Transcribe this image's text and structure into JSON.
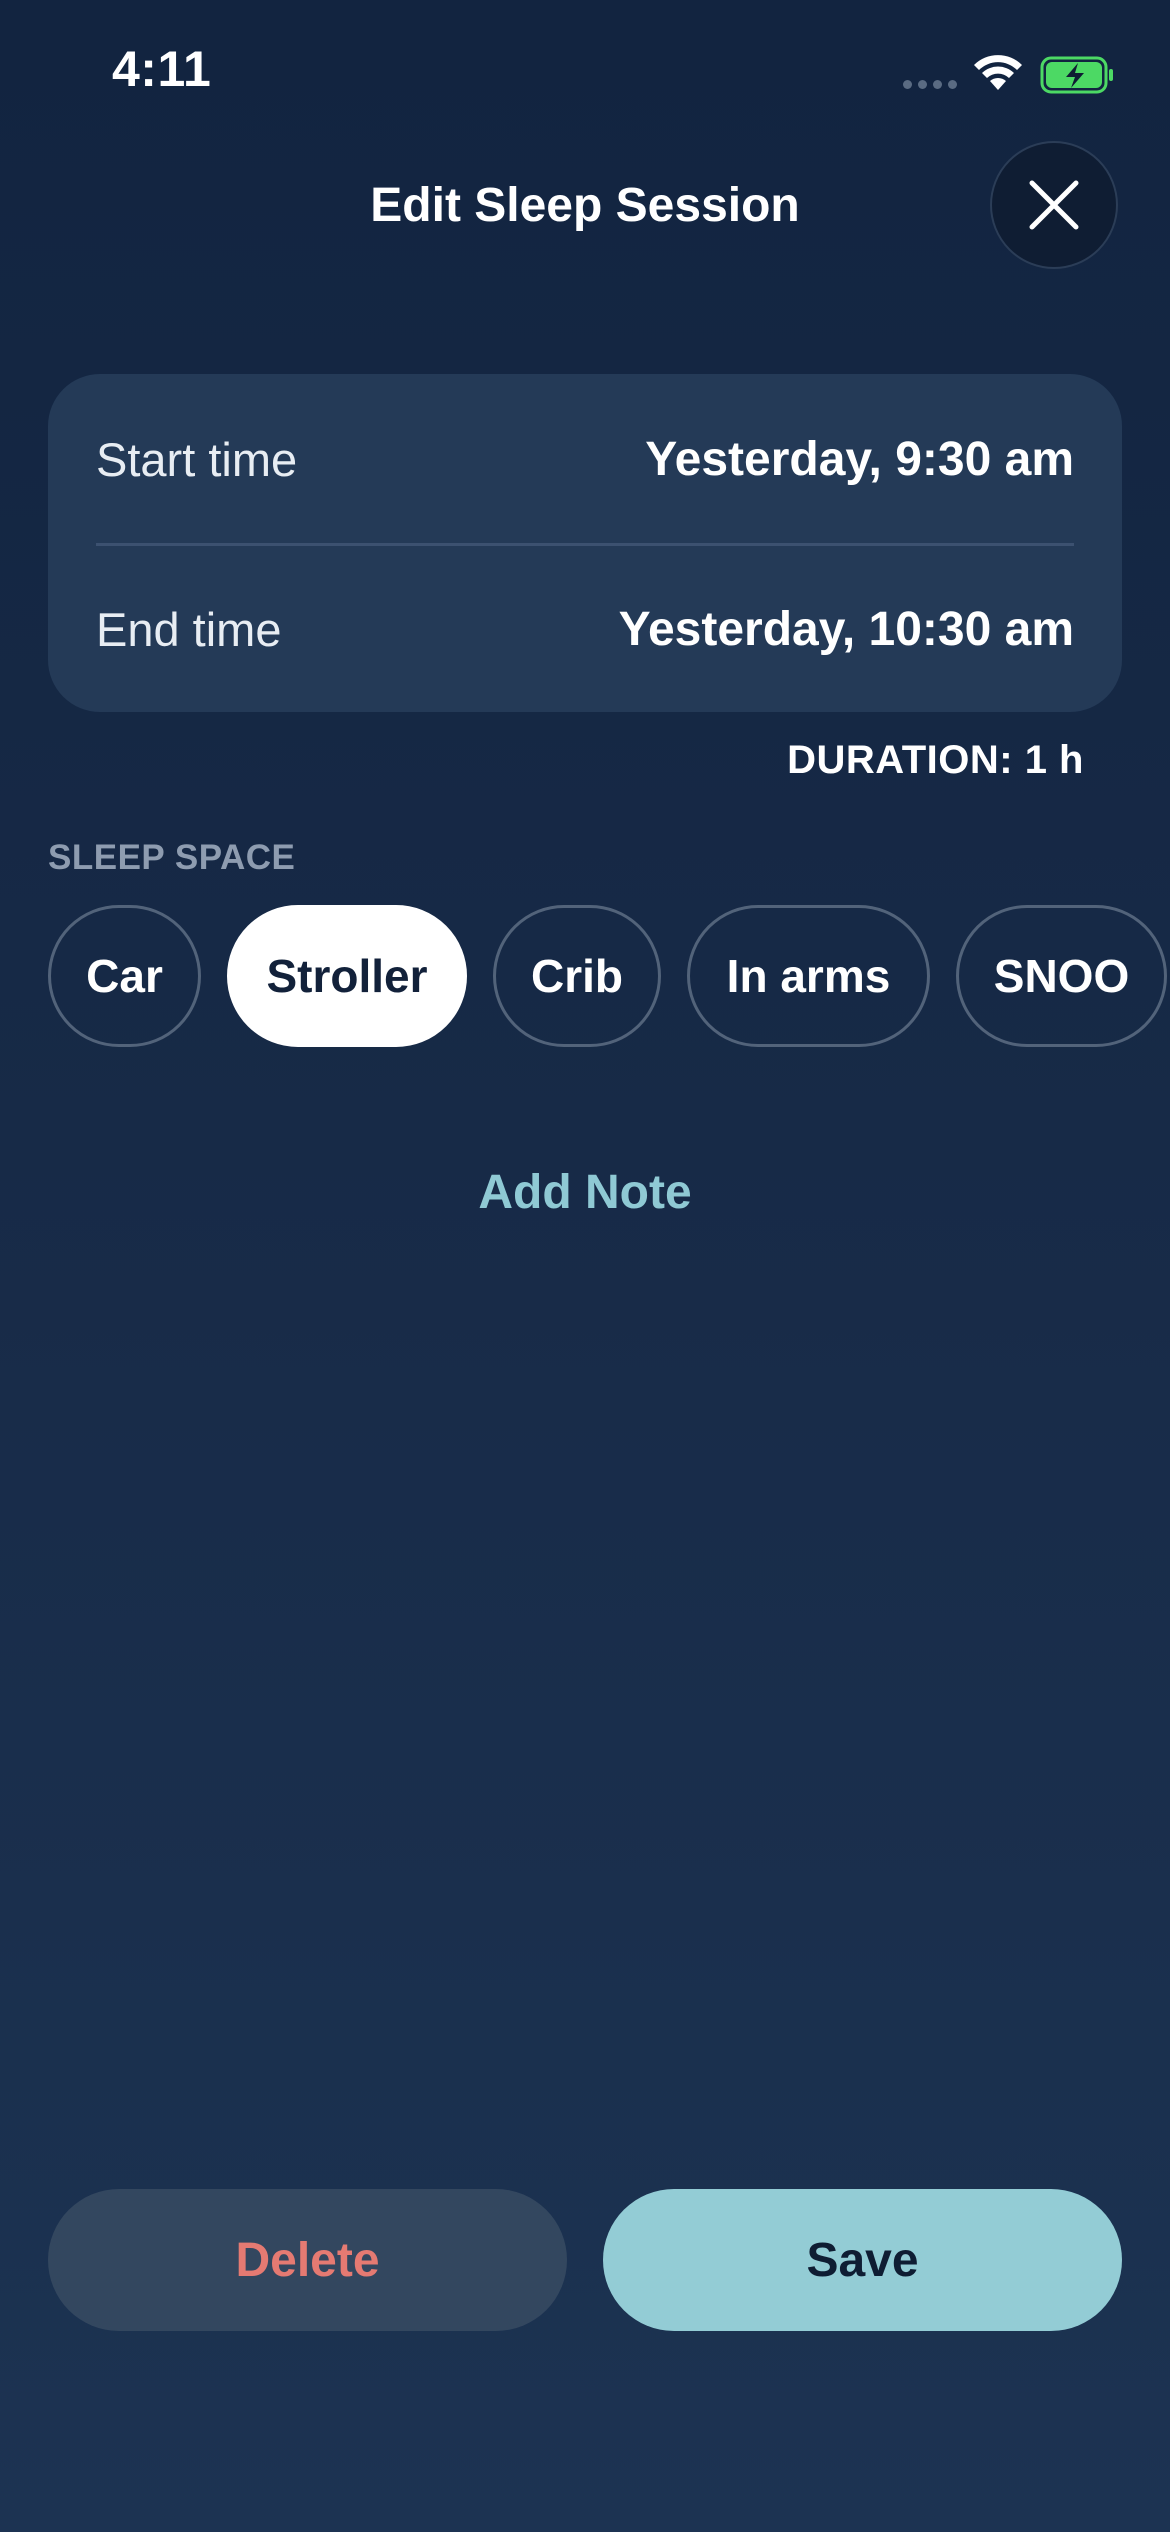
{
  "status_bar": {
    "time": "4:11",
    "battery_color": "#4cd964"
  },
  "header": {
    "title": "Edit Sleep Session",
    "close_icon": "close-icon"
  },
  "times": {
    "start_label": "Start time",
    "start_value": "Yesterday, 9:30 am",
    "end_label": "End time",
    "end_value": "Yesterday, 10:30 am"
  },
  "duration": "DURATION: 1 h",
  "sleep_space": {
    "label": "SLEEP SPACE",
    "options": [
      {
        "label": "Car",
        "selected": false
      },
      {
        "label": "Stroller",
        "selected": true
      },
      {
        "label": "Crib",
        "selected": false
      },
      {
        "label": "In arms",
        "selected": false
      },
      {
        "label": "SNOO",
        "selected": false
      }
    ]
  },
  "add_note_label": "Add Note",
  "actions": {
    "delete_label": "Delete",
    "save_label": "Save"
  },
  "colors": {
    "accent": "#93ccd5",
    "destructive": "#e57a72",
    "card": "#243a57"
  }
}
